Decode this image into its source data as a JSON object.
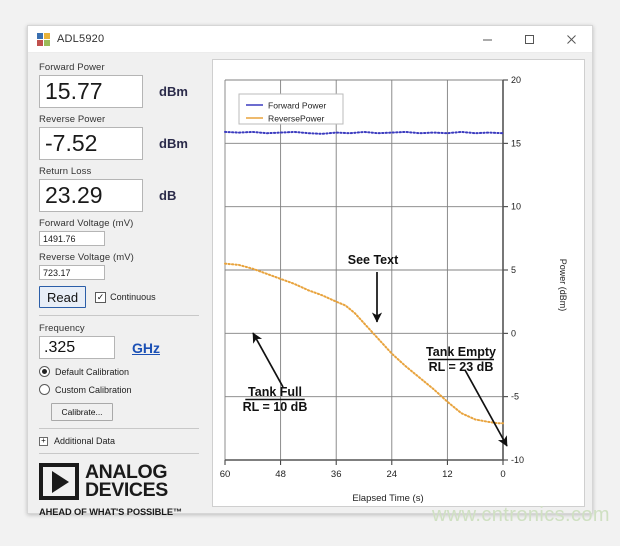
{
  "window": {
    "title": "ADL5920",
    "icon": "app-squares-icon",
    "minimize": "–",
    "maximize": "☐",
    "close": "×"
  },
  "panel": {
    "forward_power": {
      "label": "Forward Power",
      "value": "15.77",
      "unit": "dBm"
    },
    "reverse_power": {
      "label": "Reverse Power",
      "value": "-7.52",
      "unit": "dBm"
    },
    "return_loss": {
      "label": "Return Loss",
      "value": "23.29",
      "unit": "dB"
    },
    "forward_voltage": {
      "label": "Forward Voltage (mV)",
      "value": "1491.76"
    },
    "reverse_voltage": {
      "label": "Reverse Voltage (mV)",
      "value": "723.17"
    },
    "read_button": "Read",
    "continuous": {
      "label": "Continuous",
      "checked": true,
      "check_glyph": "✓"
    },
    "frequency": {
      "label": "Frequency",
      "value": ".325",
      "unit_link": "GHz"
    },
    "calibration": {
      "default": {
        "label": "Default Calibration",
        "selected": true
      },
      "custom": {
        "label": "Custom Calibration",
        "selected": false
      },
      "button": "Calibrate..."
    },
    "additional_data": {
      "label": "Additional Data",
      "expander_glyph": "+"
    },
    "logo": {
      "line1": "ANALOG",
      "line2": "DEVICES",
      "tagline": "AHEAD OF WHAT'S POSSIBLE™"
    }
  },
  "watermark": "www.cntronics.com",
  "chart_data": {
    "type": "line",
    "title": "",
    "xlabel": "Elapsed Time (s)",
    "ylabel": "Power (dBm)",
    "xlim": [
      60,
      0
    ],
    "ylim": [
      -10,
      20
    ],
    "xticks": [
      60,
      48,
      36,
      24,
      12,
      0
    ],
    "yticks": [
      -10,
      -5,
      0,
      5,
      10,
      15,
      20
    ],
    "grid": true,
    "x_axis_reversed": true,
    "legend_position": "top-left",
    "legend": [
      "Forward Power",
      "ReversePower"
    ],
    "colors": {
      "forward": "#3b3bbf",
      "reverse": "#e8a33d"
    },
    "series": [
      {
        "name": "Forward Power",
        "color": "#3b3bbf",
        "style": "dotted",
        "x": [
          60,
          57,
          54,
          51,
          48,
          45,
          42,
          39,
          36,
          33,
          30,
          27,
          24,
          21,
          18,
          15,
          12,
          9,
          6,
          3,
          0
        ],
        "values": [
          15.9,
          15.85,
          15.9,
          15.8,
          15.85,
          15.9,
          15.8,
          15.75,
          15.85,
          15.8,
          15.9,
          15.8,
          15.85,
          15.9,
          15.8,
          15.85,
          15.8,
          15.9,
          15.8,
          15.85,
          15.8
        ]
      },
      {
        "name": "ReversePower",
        "color": "#e8a33d",
        "style": "dotted",
        "x": [
          60,
          57,
          54,
          51,
          48,
          45,
          42,
          39,
          36,
          34,
          32,
          30,
          27,
          24,
          21,
          18,
          15,
          12,
          9,
          6,
          3,
          1,
          0
        ],
        "values": [
          5.5,
          5.4,
          5.1,
          4.7,
          4.3,
          3.9,
          3.4,
          3.0,
          2.5,
          2.2,
          1.6,
          0.8,
          -0.4,
          -1.6,
          -2.6,
          -3.5,
          -4.4,
          -5.4,
          -6.3,
          -6.8,
          -7.0,
          -7.1,
          -7.1
        ]
      }
    ],
    "annotations": [
      {
        "name": "tank-full",
        "text_line1": "Tank Full",
        "text_line2": "RL = 10 dB",
        "underline": true,
        "arrow": "up-left"
      },
      {
        "name": "see-text",
        "text_line1": "See Text",
        "text_line2": "",
        "underline": false,
        "arrow": "down"
      },
      {
        "name": "tank-empty",
        "text_line1": "Tank Empty",
        "text_line2": "RL = 23 dB",
        "underline": true,
        "arrow": "down-right"
      }
    ]
  }
}
